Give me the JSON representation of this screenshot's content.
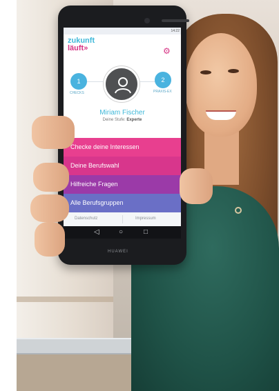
{
  "app": {
    "logo_line1": "zukunft",
    "logo_line2": "läuft»",
    "user_name": "Miriam Fischer",
    "level_label": "Deine Stufe:",
    "level_value": "Experte",
    "stage_left_label": "CHECKS",
    "stage_right_label": "PRAXIS-EX",
    "stage_left_number": "1",
    "stage_right_number": "2",
    "menu": [
      {
        "label": "Checke deine Interessen",
        "color": "#e83f8f"
      },
      {
        "label": "Deine Berufswahl",
        "color": "#d8368c"
      },
      {
        "label": "Hilfreiche Fragen",
        "color": "#9b3aa8"
      },
      {
        "label": "Alle Berufsgruppen",
        "color": "#6a6fc6"
      }
    ],
    "footer": {
      "left": "Datenschutz",
      "right": "Impressum"
    },
    "status": {
      "left": "",
      "right": "14:22"
    },
    "brand": "HUAWEI"
  },
  "icons": {
    "settings": "gear-icon",
    "avatar": "user-avatar-icon",
    "nav_back": "back-icon",
    "nav_home": "home-icon",
    "nav_recent": "recent-apps-icon"
  },
  "colors": {
    "accent_blue": "#3fb8d9",
    "accent_pink": "#e83f8f",
    "accent_purple": "#9b3aa8",
    "accent_indigo": "#6a6fc6"
  }
}
